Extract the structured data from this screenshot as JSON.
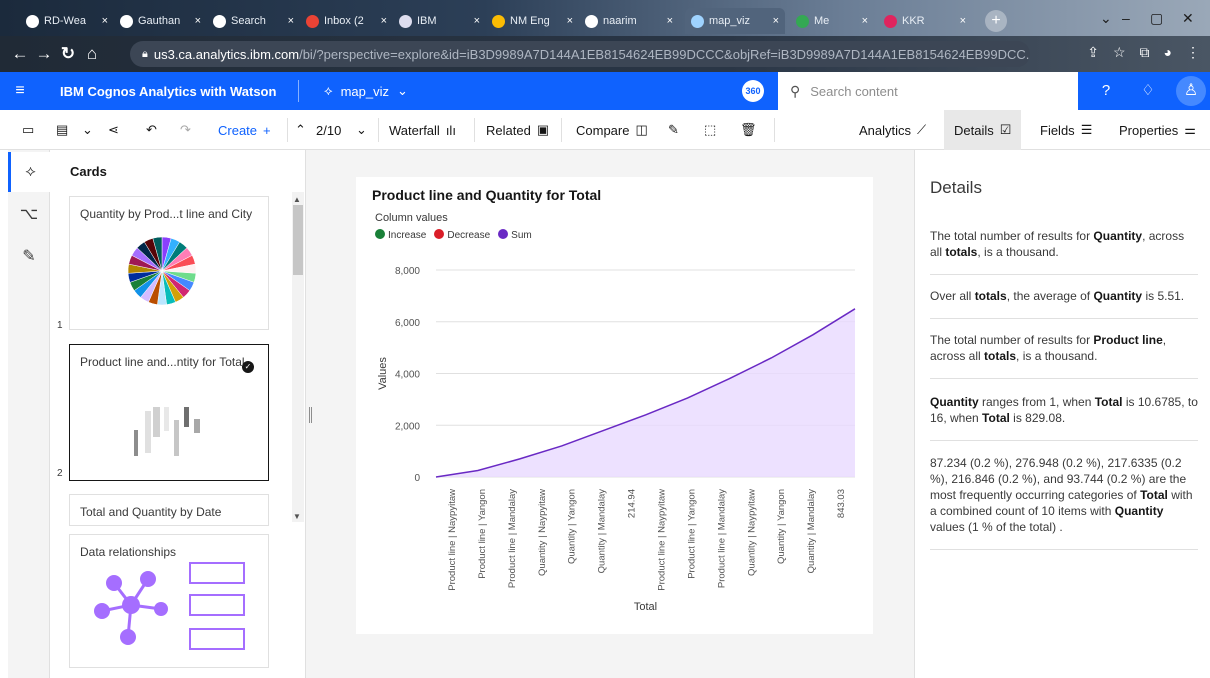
{
  "browser": {
    "tabs": [
      {
        "title": "RD-Wea"
      },
      {
        "title": "Gauthan"
      },
      {
        "title": "Search"
      },
      {
        "title": "Inbox (2"
      },
      {
        "title": "IBM"
      },
      {
        "title": "NM Eng"
      },
      {
        "title": "naarim"
      },
      {
        "title": "map_viz"
      },
      {
        "title": "Me"
      },
      {
        "title": "KKR"
      }
    ],
    "url_main": "us3.ca.analytics.ibm.com",
    "url_rest": "/bi/?perspective=explore&id=iB3D9989A7D144A1EB8154624EB99DCCC&objRef=iB3D9989A7D144A1EB8154624EB99DCC..."
  },
  "header": {
    "app_name": "IBM Cognos Analytics with Watson",
    "doc_name": "map_viz",
    "badge": "360",
    "search_placeholder": "Search content"
  },
  "toolbar": {
    "create": "Create",
    "counter": "2/10",
    "waterfall": "Waterfall",
    "related": "Related",
    "compare": "Compare",
    "analytics": "Analytics",
    "details": "Details",
    "fields": "Fields",
    "properties": "Properties"
  },
  "cards_panel": {
    "title": "Cards",
    "cards": [
      {
        "title": "Quantity by Prod...t line and City",
        "num": "1"
      },
      {
        "title": "Product line and...ntity for Total",
        "num": "2"
      },
      {
        "title": "Total and Quantity by Date",
        "num": ""
      },
      {
        "title": "Data relationships",
        "num": ""
      }
    ],
    "pie_colors": [
      "#8a3ffc",
      "#33b1ff",
      "#007d79",
      "#ff7eb6",
      "#fa4d56",
      "#fff1f1",
      "#6fdc8c",
      "#4589ff",
      "#d12771",
      "#d2a106",
      "#08bdba",
      "#bae6ff",
      "#ba4e00",
      "#d4bbff",
      "#1192e8",
      "#198038",
      "#002d9c",
      "#b28600",
      "#9f1853",
      "#a56eff",
      "#012749",
      "#570408",
      "#005d5d"
    ]
  },
  "chart_data": {
    "type": "area",
    "title": "Product line and Quantity for Total",
    "legend_title": "Column values",
    "legend": [
      {
        "name": "Increase",
        "color": "#198038"
      },
      {
        "name": "Decrease",
        "color": "#da1e28"
      },
      {
        "name": "Sum",
        "color": "#6929c4"
      }
    ],
    "xlabel": "Total",
    "ylabel": "Values",
    "ylim": [
      0,
      8000
    ],
    "yticks": [
      "0",
      "2,000",
      "4,000",
      "6,000",
      "8,000"
    ],
    "categories": [
      "Product line | Naypyitaw",
      "Product line | Yangon",
      "Product line | Mandalay",
      "Quantity | Naypyitaw",
      "Quantity | Yangon",
      "Quantity | Mandalay",
      "214.94",
      "Product line | Naypyitaw",
      "Product line | Yangon",
      "Product line | Mandalay",
      "Quantity | Naypyitaw",
      "Quantity | Yangon",
      "Quantity | Mandalay",
      "843.03"
    ],
    "series": [
      {
        "name": "Sum",
        "x": [
          0,
          0.1,
          0.2,
          0.3,
          0.4,
          0.5,
          0.6,
          0.7,
          0.8,
          0.9,
          1.0
        ],
        "y": [
          0,
          250,
          700,
          1200,
          1800,
          2400,
          3050,
          3800,
          4600,
          5500,
          6500
        ]
      }
    ],
    "grid": "horizontal"
  },
  "details": {
    "title": "Details",
    "paragraphs": [
      [
        "The total number of results for ",
        {
          "b": "Quantity"
        },
        ", across all ",
        {
          "b": "totals"
        },
        ", is a thousand."
      ],
      [
        "Over all ",
        {
          "b": "totals"
        },
        ", the average of ",
        {
          "b": "Quantity"
        },
        " is 5.51."
      ],
      [
        "The total number of results for ",
        {
          "b": "Product line"
        },
        ", across all ",
        {
          "b": "totals"
        },
        ", is a thousand."
      ],
      [
        {
          "b": "Quantity"
        },
        " ranges from 1, when ",
        {
          "b": "Total"
        },
        " is 10.6785, to 16, when ",
        {
          "b": "Total"
        },
        " is 829.08."
      ],
      [
        "87.234 (0.2 %), 276.948 (0.2 %), 217.6335 (0.2 %), 216.846 (0.2 %), and 93.744 (0.2 %) are the most frequently occurring categories of ",
        {
          "b": "Total"
        },
        " with a combined count of 10 items with ",
        {
          "b": "Quantity"
        },
        " values (1 % of the total) ."
      ]
    ]
  }
}
